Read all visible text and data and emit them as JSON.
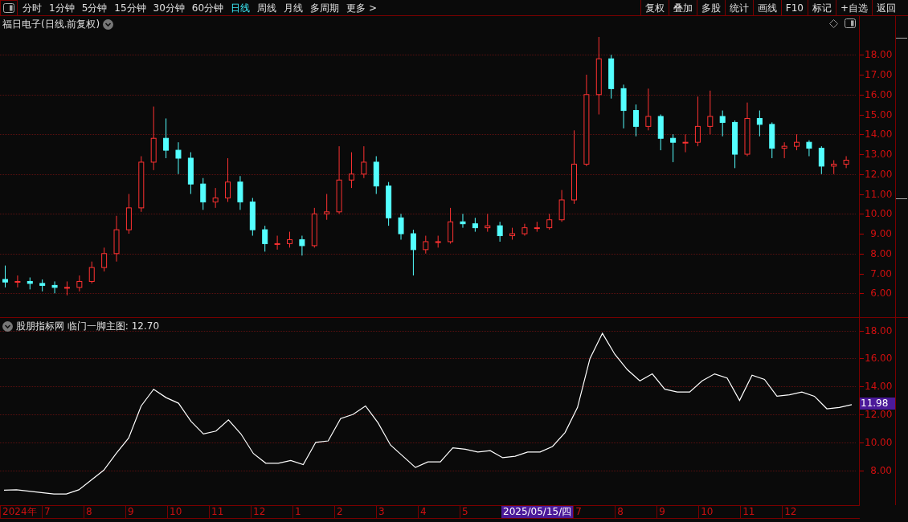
{
  "toolbar": {
    "periods": [
      {
        "label": "分时",
        "selected": false
      },
      {
        "label": "1分钟",
        "selected": false
      },
      {
        "label": "5分钟",
        "selected": false
      },
      {
        "label": "15分钟",
        "selected": false
      },
      {
        "label": "30分钟",
        "selected": false
      },
      {
        "label": "60分钟",
        "selected": false
      },
      {
        "label": "日线",
        "selected": true
      },
      {
        "label": "周线",
        "selected": false
      },
      {
        "label": "月线",
        "selected": false
      },
      {
        "label": "多周期",
        "selected": false
      },
      {
        "label": "更多 >",
        "selected": false
      }
    ],
    "buttons": [
      "复权",
      "叠加",
      "多股",
      "统计",
      "画线",
      "F10",
      "标记",
      "+自选",
      "返回"
    ]
  },
  "main_panel": {
    "title": "福日电子(日线.前复权)",
    "chart_data": {
      "type": "candlestick",
      "grid": true,
      "ylim": [
        4.8,
        19.95
      ],
      "yticks": [
        {
          "value": 18,
          "label": "18.00"
        },
        {
          "value": 17,
          "label": "17.00"
        },
        {
          "value": 16,
          "label": "16.00"
        },
        {
          "value": 15,
          "label": "15.00"
        },
        {
          "value": 14,
          "label": "14.00"
        },
        {
          "value": 13,
          "label": "13.00"
        },
        {
          "value": 12,
          "label": "12.00"
        },
        {
          "value": 11,
          "label": "11.00"
        },
        {
          "value": 10,
          "label": "10.00"
        },
        {
          "value": 9,
          "label": "9.00"
        },
        {
          "value": 8,
          "label": "8.00"
        },
        {
          "value": 7,
          "label": "7.00"
        },
        {
          "value": 6,
          "label": "6.00"
        }
      ],
      "ohlc": [
        [
          6.7,
          7.4,
          6.3,
          6.57
        ],
        [
          6.57,
          6.9,
          6.3,
          6.6
        ],
        [
          6.6,
          6.8,
          6.2,
          6.5
        ],
        [
          6.5,
          6.7,
          6.1,
          6.4
        ],
        [
          6.4,
          6.6,
          6.0,
          6.3
        ],
        [
          6.3,
          6.6,
          5.9,
          6.3
        ],
        [
          6.3,
          6.9,
          6.1,
          6.6
        ],
        [
          6.6,
          7.6,
          6.5,
          7.3
        ],
        [
          7.3,
          8.3,
          7.1,
          8.0
        ],
        [
          8.0,
          9.9,
          7.6,
          9.2
        ],
        [
          9.2,
          11.0,
          9.0,
          10.3
        ],
        [
          10.3,
          12.9,
          10.1,
          12.6
        ],
        [
          12.6,
          15.4,
          12.2,
          13.8
        ],
        [
          13.8,
          14.8,
          12.8,
          13.2
        ],
        [
          13.2,
          13.6,
          12.0,
          12.8
        ],
        [
          12.8,
          13.1,
          11.0,
          11.5
        ],
        [
          11.5,
          11.8,
          10.2,
          10.6
        ],
        [
          10.6,
          11.3,
          10.3,
          10.8
        ],
        [
          10.8,
          12.8,
          10.6,
          11.6
        ],
        [
          11.6,
          11.9,
          10.2,
          10.6
        ],
        [
          10.6,
          10.8,
          8.9,
          9.2
        ],
        [
          9.2,
          9.4,
          8.1,
          8.5
        ],
        [
          8.5,
          8.9,
          8.2,
          8.5
        ],
        [
          8.5,
          9.1,
          8.3,
          8.7
        ],
        [
          8.7,
          8.9,
          7.9,
          8.4
        ],
        [
          8.4,
          10.3,
          8.3,
          10.0
        ],
        [
          10.0,
          11.0,
          9.7,
          10.1
        ],
        [
          10.1,
          13.4,
          10.0,
          11.7
        ],
        [
          11.7,
          13.1,
          11.3,
          12.0
        ],
        [
          12.0,
          13.4,
          11.8,
          12.6
        ],
        [
          12.6,
          12.9,
          11.0,
          11.4
        ],
        [
          11.4,
          11.6,
          9.4,
          9.8
        ],
        [
          9.8,
          10.0,
          8.7,
          9.0
        ],
        [
          9.0,
          9.2,
          6.9,
          8.2
        ],
        [
          8.2,
          8.9,
          8.0,
          8.6
        ],
        [
          8.6,
          8.9,
          8.3,
          8.6
        ],
        [
          8.6,
          10.3,
          8.5,
          9.6
        ],
        [
          9.6,
          10.0,
          9.3,
          9.5
        ],
        [
          9.5,
          9.8,
          9.1,
          9.3
        ],
        [
          9.3,
          10.0,
          9.1,
          9.4
        ],
        [
          9.4,
          9.6,
          8.6,
          8.9
        ],
        [
          8.9,
          9.3,
          8.7,
          9.0
        ],
        [
          9.0,
          9.5,
          8.9,
          9.3
        ],
        [
          9.3,
          9.6,
          9.1,
          9.3
        ],
        [
          9.3,
          10.0,
          9.2,
          9.7
        ],
        [
          9.7,
          11.2,
          9.6,
          10.7
        ],
        [
          10.7,
          14.2,
          10.5,
          12.5
        ],
        [
          12.5,
          17.0,
          12.4,
          16.0
        ],
        [
          16.0,
          18.9,
          15.0,
          17.8
        ],
        [
          17.8,
          18.0,
          15.8,
          16.3
        ],
        [
          16.3,
          16.5,
          14.3,
          15.2
        ],
        [
          15.2,
          15.5,
          13.9,
          14.4
        ],
        [
          14.4,
          16.3,
          14.2,
          14.9
        ],
        [
          14.9,
          15.0,
          13.2,
          13.8
        ],
        [
          13.8,
          14.0,
          12.6,
          13.6
        ],
        [
          13.6,
          14.0,
          13.1,
          13.6
        ],
        [
          13.6,
          15.9,
          13.4,
          14.4
        ],
        [
          14.4,
          16.2,
          14.0,
          14.9
        ],
        [
          14.9,
          15.2,
          13.9,
          14.6
        ],
        [
          14.6,
          14.7,
          12.3,
          13.0
        ],
        [
          13.0,
          15.6,
          12.9,
          14.8
        ],
        [
          14.8,
          15.2,
          13.9,
          14.5
        ],
        [
          14.5,
          14.6,
          12.8,
          13.3
        ],
        [
          13.3,
          13.6,
          12.8,
          13.4
        ],
        [
          13.4,
          14.0,
          13.2,
          13.6
        ],
        [
          13.6,
          13.7,
          12.9,
          13.3
        ],
        [
          13.3,
          13.4,
          12.0,
          12.4
        ],
        [
          12.4,
          12.7,
          12.0,
          12.5
        ],
        [
          12.5,
          12.9,
          12.3,
          12.7
        ]
      ]
    }
  },
  "indicator_panel": {
    "title": "股朋指标网 临门一脚主图: 12.70",
    "current_value": "11.98",
    "chart_data": {
      "type": "line",
      "grid": true,
      "ylim": [
        5.5,
        18.9
      ],
      "yticks": [
        {
          "value": 8,
          "label": "8.00"
        },
        {
          "value": 10,
          "label": "10.00"
        },
        {
          "value": 12,
          "label": "12.00"
        },
        {
          "value": 14,
          "label": "14.00"
        },
        {
          "value": 16,
          "label": "16.00"
        },
        {
          "value": 18,
          "label": "18.00"
        }
      ],
      "series": [
        {
          "color": "#ffffff",
          "values": [
            6.57,
            6.6,
            6.5,
            6.4,
            6.3,
            6.3,
            6.6,
            7.3,
            8.0,
            9.2,
            10.3,
            12.6,
            13.8,
            13.2,
            12.8,
            11.5,
            10.6,
            10.8,
            11.6,
            10.6,
            9.2,
            8.5,
            8.5,
            8.7,
            8.4,
            10.0,
            10.1,
            11.7,
            12.0,
            12.6,
            11.4,
            9.8,
            9.0,
            8.2,
            8.6,
            8.6,
            9.6,
            9.5,
            9.3,
            9.4,
            8.9,
            9.0,
            9.3,
            9.3,
            9.7,
            10.7,
            12.5,
            16.0,
            17.8,
            16.3,
            15.2,
            14.4,
            14.9,
            13.8,
            13.6,
            13.6,
            14.4,
            14.9,
            14.6,
            13.0,
            14.8,
            14.5,
            13.3,
            13.4,
            13.6,
            13.3,
            12.4,
            12.5,
            12.7
          ]
        }
      ]
    }
  },
  "date_axis": [
    {
      "label": "2024年",
      "selected": false
    },
    {
      "label": "7",
      "selected": false
    },
    {
      "label": "8",
      "selected": false
    },
    {
      "label": "9",
      "selected": false
    },
    {
      "label": "10",
      "selected": false
    },
    {
      "label": "11",
      "selected": false
    },
    {
      "label": "12",
      "selected": false
    },
    {
      "label": "1",
      "selected": false
    },
    {
      "label": "2",
      "selected": false
    },
    {
      "label": "3",
      "selected": false
    },
    {
      "label": "4",
      "selected": false
    },
    {
      "label": "5",
      "selected": false
    },
    {
      "label": "2025/05/15/四",
      "selected": true
    },
    {
      "label": "7",
      "selected": false
    },
    {
      "label": "8",
      "selected": false
    },
    {
      "label": "9",
      "selected": false
    },
    {
      "label": "10",
      "selected": false
    },
    {
      "label": "11",
      "selected": false
    },
    {
      "label": "12",
      "selected": false
    }
  ]
}
